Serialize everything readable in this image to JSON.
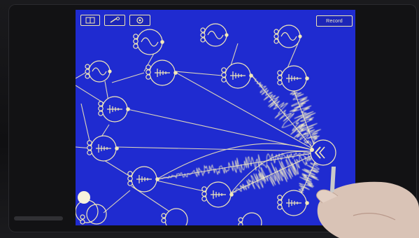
{
  "app": {
    "toolbar": {
      "panel_icon": "panel-icon",
      "wrench_icon": "wrench-icon",
      "settings_icon": "gear-icon",
      "record_label": "Record"
    },
    "colors": {
      "canvas": "#1f2bd0",
      "ink": "#f3e9b8",
      "toolbar_fill": "#1c25b8"
    },
    "modules": [
      {
        "kind": "oscillator",
        "icon": "sine-wave-icon"
      },
      {
        "kind": "oscillator",
        "icon": "sine-wave-icon"
      },
      {
        "kind": "oscillator",
        "icon": "sine-wave-icon"
      },
      {
        "kind": "oscillator",
        "icon": "sine-wave-icon"
      },
      {
        "kind": "sequencer",
        "icon": "sequencer-icon"
      },
      {
        "kind": "sequencer",
        "icon": "sequencer-icon"
      },
      {
        "kind": "sequencer",
        "icon": "sequencer-icon"
      },
      {
        "kind": "sequencer",
        "icon": "sequencer-icon"
      },
      {
        "kind": "sequencer",
        "icon": "sequencer-icon"
      },
      {
        "kind": "sequencer",
        "icon": "sequencer-icon"
      },
      {
        "kind": "sequencer",
        "icon": "sequencer-icon"
      },
      {
        "kind": "sequencer",
        "icon": "sequencer-icon"
      },
      {
        "kind": "output",
        "icon": "speaker-icon"
      }
    ]
  }
}
